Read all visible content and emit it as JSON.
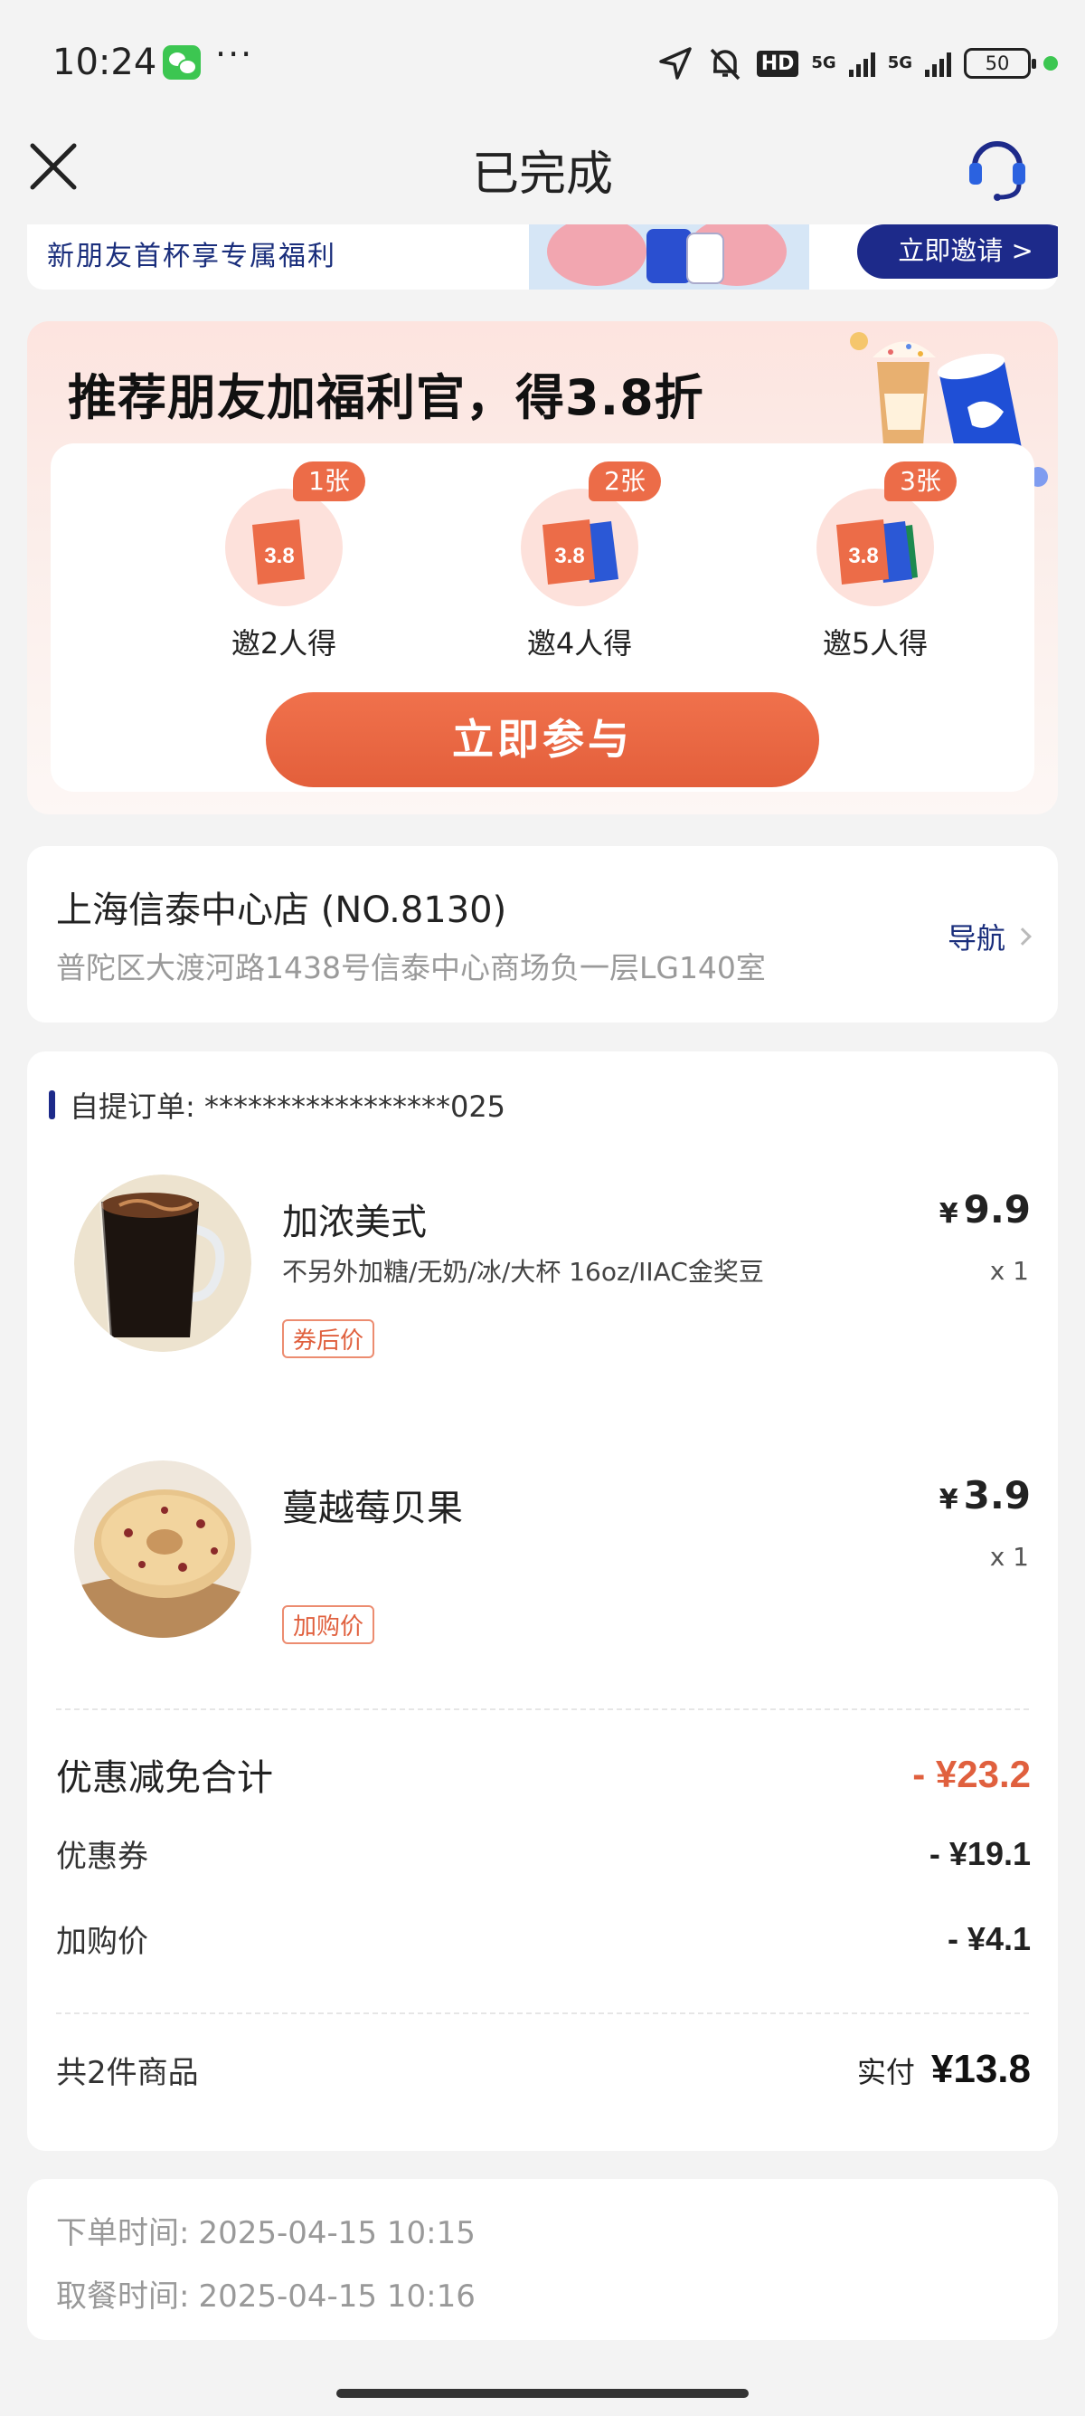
{
  "status_bar": {
    "time": "10:24",
    "dots": "···",
    "hd": "HD",
    "net1": "5G",
    "net2": "5G",
    "battery": "50"
  },
  "nav": {
    "title": "已完成",
    "close_icon": "close-icon",
    "service_icon": "headset-icon"
  },
  "invite_banner": {
    "text": "新朋友首杯享专属福利",
    "button": "立即邀请 >"
  },
  "referral": {
    "title": "推荐朋友加福利官，得3.8折",
    "coupon_value": "3.8",
    "tiers": [
      {
        "badge": "1张",
        "label": "邀2人得"
      },
      {
        "badge": "2张",
        "label": "邀4人得"
      },
      {
        "badge": "3张",
        "label": "邀5人得"
      }
    ],
    "button": "立即参与"
  },
  "store": {
    "name": "上海信泰中心店 (NO.8130)",
    "address": "普陀区大渡河路1438号信泰中心商场负一层LG140室",
    "nav_label": "导航"
  },
  "order": {
    "id_label": "自提订单: *****************025",
    "items": [
      {
        "name": "加浓美式",
        "spec": "不另外加糖/无奶/冰/大杯 16oz/IIAC金奖豆",
        "tag": "券后价",
        "currency": "¥",
        "price": "9.9",
        "qty": "x 1"
      },
      {
        "name": "蔓越莓贝果",
        "spec": "",
        "tag": "加购价",
        "currency": "¥",
        "price": "3.9",
        "qty": "x 1"
      }
    ],
    "discount_total_label": "优惠减免合计",
    "discount_total_value": "- ¥23.2",
    "coupon_label": "优惠券",
    "coupon_value": "- ¥19.1",
    "addon_label": "加购价",
    "addon_value": "- ¥4.1",
    "count_label": "共2件商品",
    "paid_label": "实付",
    "paid_value": "¥13.8"
  },
  "times": {
    "order_time_label": "下单时间:",
    "order_time": "2025-04-15 10:15",
    "pickup_time_label": "取餐时间:",
    "pickup_time": "2025-04-15 10:16"
  },
  "colors": {
    "accent": "#e0603e",
    "brand_blue": "#1d2a8a",
    "background": "#f3f3f3"
  }
}
